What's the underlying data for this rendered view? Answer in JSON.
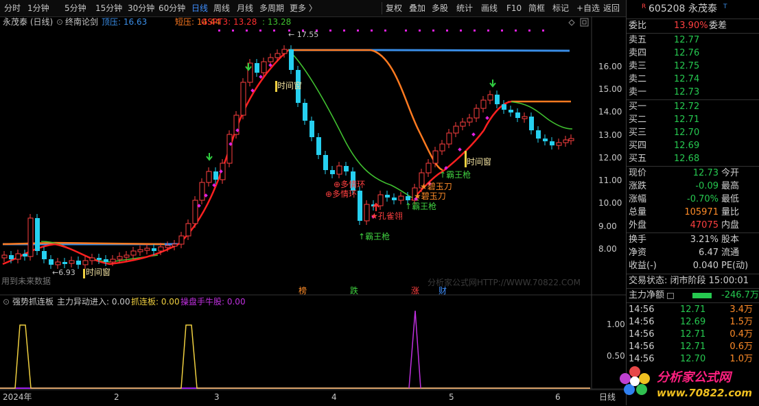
{
  "toolbar": {
    "left": [
      "分时",
      "1分钟",
      "5分钟",
      "15分钟",
      "30分钟",
      "60分钟",
      "日线",
      "周线",
      "月线",
      "多周期",
      "更多 〉"
    ],
    "active": "日线",
    "right": [
      "复权",
      "叠加",
      "多股",
      "统计",
      "画线",
      "F10",
      "简框",
      "标记",
      "+自选",
      "返回"
    ]
  },
  "main_legend": {
    "stock": "永茂泰 (日线)",
    "indicator": "终南论剑",
    "top_label": "顶压: 16.63",
    "short_label": "短压: 14.44",
    "gspt_label": "GSPT3: 13.28",
    "extra_label": ": 13.28"
  },
  "sub_legend": {
    "name": "强势抓连板",
    "item1": "主力异动进入: 0.00",
    "item2": "抓连板: 0.00",
    "item3": "操盘手牛股: 0.00"
  },
  "watermarks": {
    "future": "用到未来数据",
    "site": "分析家公式网HTTP://WWW.70822.COM"
  },
  "annotations": {
    "high": "17.55",
    "low": "6.93",
    "time1": "时间窗",
    "time2": "时间窗",
    "time3": "时间窗",
    "duoqing1": "多情环",
    "duoqing2": "多情环",
    "bawang1": "霸王枪",
    "bawang2": "霸王枪",
    "bawang3": "霸王枪",
    "biyu1": "碧玉刀",
    "biyu2": "碧玉刀",
    "kongque": "孔雀翎",
    "bang": "榜",
    "die": "跌",
    "zhang": "涨",
    "cai": "财"
  },
  "y_ticks_main": [
    "16.00",
    "15.00",
    "14.00",
    "13.00",
    "12.00",
    "11.00",
    "10.00",
    "9.00",
    "8.00"
  ],
  "y_ticks_sub": [
    "1.00",
    "0.50"
  ],
  "x_labels": [
    "2024年",
    "2",
    "3",
    "4",
    "5",
    "6"
  ],
  "x_period": "日线",
  "right_panel": {
    "code": "605208",
    "name": "永茂泰",
    "weibi_label": "委比",
    "weibi": "13.90%",
    "weicha_label": "委差",
    "asks": [
      {
        "l": "卖五",
        "p": "12.77"
      },
      {
        "l": "卖四",
        "p": "12.76"
      },
      {
        "l": "卖三",
        "p": "12.75"
      },
      {
        "l": "卖二",
        "p": "12.74"
      },
      {
        "l": "卖一",
        "p": "12.73"
      }
    ],
    "bids": [
      {
        "l": "买一",
        "p": "12.72"
      },
      {
        "l": "买二",
        "p": "12.71"
      },
      {
        "l": "买三",
        "p": "12.70"
      },
      {
        "l": "买四",
        "p": "12.69"
      },
      {
        "l": "买五",
        "p": "12.68"
      }
    ],
    "stats": [
      {
        "l": "现价",
        "v": "12.73",
        "l2": "今开"
      },
      {
        "l": "涨跌",
        "v": "-0.09",
        "l2": "最高"
      },
      {
        "l": "涨幅",
        "v": "-0.70%",
        "l2": "最低"
      },
      {
        "l": "总量",
        "v": "105971",
        "l2": "量比"
      },
      {
        "l": "外盘",
        "v": "47075",
        "l2": "内盘"
      }
    ],
    "fin": [
      {
        "l": "换手",
        "v": "3.21%",
        "l2": "股本"
      },
      {
        "l": "净资",
        "v": "6.47",
        "l2": "流通"
      },
      {
        "l": "收益(-)",
        "v": "0.040",
        "l2": "PE(动)"
      }
    ],
    "status": "交易状态: 闭市阶段 15:00:01",
    "net_label": "主力净额",
    "net_value": "-246.7万",
    "ticks": [
      {
        "t": "14:56",
        "p": "12.71",
        "v": "3.4万"
      },
      {
        "t": "14:56",
        "p": "12.69",
        "v": "1.5万"
      },
      {
        "t": "14:56",
        "p": "12.71",
        "v": "0.4万"
      },
      {
        "t": "14:56",
        "p": "12.71",
        "v": "0.6万"
      },
      {
        "t": "14:56",
        "p": "12.70",
        "v": "1.0万"
      }
    ],
    "logo_text": "分析家公式网",
    "logo_url": "www.70822.com"
  },
  "colors": {
    "up": "#ff4040",
    "down": "#26d0f0",
    "grid": "#2a2a2a",
    "mainline": "#ff3030"
  }
}
